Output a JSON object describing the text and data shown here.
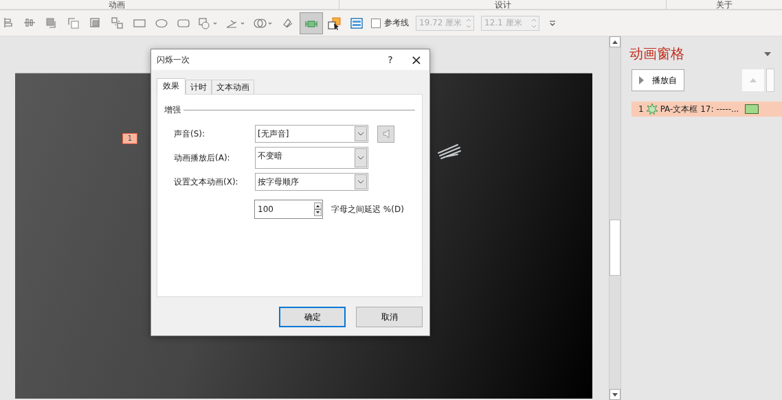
{
  "ribbon_tabs": [
    {
      "label": "动画"
    },
    {
      "label": "设计"
    },
    {
      "label": "关于"
    }
  ],
  "toolbar": {
    "tools": [
      {
        "selected": false
      },
      {
        "selected": false
      },
      {
        "selected": false
      },
      {
        "selected": false
      },
      {
        "selected": false
      },
      {
        "selected": false
      },
      {
        "selected": false
      },
      {
        "selected": false
      },
      {
        "selected": false
      },
      {
        "selected": false
      },
      {
        "selected": false
      },
      {
        "selected": false
      },
      {
        "selected": false
      },
      {
        "selected": true
      },
      {
        "selected": false
      },
      {
        "selected": false
      }
    ],
    "guides": {
      "label": "参考线",
      "checked": false
    },
    "width": {
      "value": "19.72 厘米",
      "disabled": true
    },
    "height": {
      "value": "12.1 厘米",
      "disabled": true
    }
  },
  "slide": {
    "badge": "1"
  },
  "dialog": {
    "title": "闪烁一次",
    "help": "?",
    "close": "×",
    "tabs": [
      {
        "label": "效果",
        "selected": true
      },
      {
        "label": "计时",
        "selected": false
      },
      {
        "label": "文本动画",
        "selected": false
      }
    ],
    "group": "增强",
    "rows": [
      {
        "label": "声音(S):",
        "value": "[无声音]",
        "kind": "sound"
      },
      {
        "label": "动画播放后(A):",
        "value": "不变暗",
        "kind": "tall"
      },
      {
        "label": "设置文本动画(X):",
        "value": "按字母顺序",
        "kind": "plain"
      }
    ],
    "delay": {
      "value": "100",
      "label": "字母之间延迟 %(D)"
    },
    "buttons": [
      {
        "label": "确定",
        "default": true
      },
      {
        "label": "取消",
        "default": false
      }
    ]
  },
  "animation_pane": {
    "title": "动画窗格",
    "play_button": "播放自",
    "items": [
      {
        "number": "1",
        "name": "PA-文本框 17: -----...",
        "selected": true
      }
    ]
  }
}
